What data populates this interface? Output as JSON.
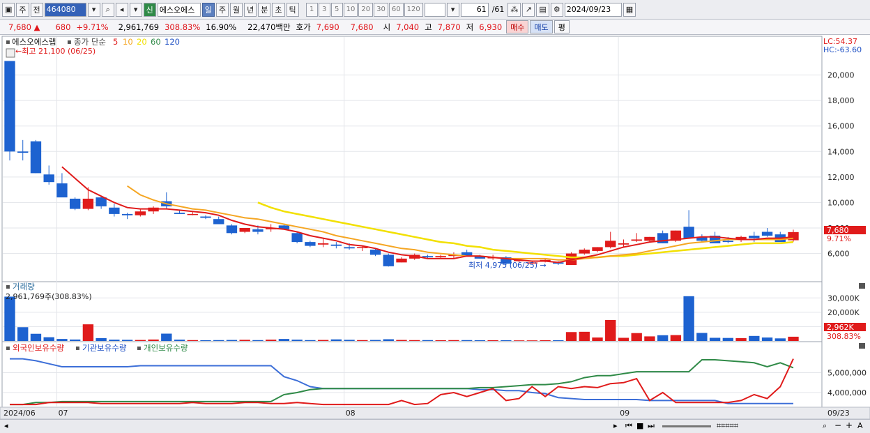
{
  "toolbar": {
    "type_label": "주",
    "market_label": "전",
    "stock_code": "464080",
    "stock_name": "에스오에스",
    "new_badge": "신",
    "periods": [
      "일",
      "주",
      "월",
      "년",
      "분",
      "초",
      "틱"
    ],
    "active_period": "일",
    "numbers": [
      "1",
      "3",
      "5",
      "10",
      "20",
      "30",
      "60",
      "120"
    ],
    "count": "61",
    "count_total": "/61",
    "date": "2024/09/23"
  },
  "quote": {
    "price": "7,680",
    "change_arrow": "▲",
    "change": "680",
    "change_pct": "+9.71%",
    "volume": "2,961,769",
    "volume_pct": "308.83%",
    "turnover": "16.90%",
    "amount": "22,470백만",
    "bid_label": "호가",
    "bid1": "7,690",
    "bid2": "7,680",
    "open_label": "시",
    "open": "7,040",
    "high_label": "고",
    "high": "7,870",
    "low_label": "저",
    "low": "6,930",
    "buy_label": "매수",
    "sell_label": "매도",
    "avg_label": "평"
  },
  "price_panel": {
    "legend_name": "에스오에스랩",
    "legend_ma_label": "종가 단순",
    "ma_periods": [
      "5",
      "10",
      "20",
      "60",
      "120"
    ],
    "ma_colors": [
      "#e01b1b",
      "#f5a623",
      "#f2e000",
      "#2f8a47",
      "#1d4fc4"
    ],
    "high_note": "←최고 21,100 (06/25)",
    "low_note": "최저 4,975 (06/25) →",
    "lc_label": "LC:54.37",
    "hc_label": "HC:-63.60",
    "y_ticks": [
      "20,000",
      "18,000",
      "16,000",
      "14,000",
      "12,000",
      "10,000",
      "8,000",
      "6,000"
    ],
    "last_price_tag": "7,680",
    "last_pct_tag": "9.71%"
  },
  "volume_panel": {
    "title": "거래량",
    "value_note": "2,961,769주(308.83%)",
    "y_ticks": [
      "30,000K",
      "20,000K",
      "10,000K"
    ],
    "last_tag": "2,962K",
    "last_pct_tag": "308.83%"
  },
  "holdings_panel": {
    "legend": [
      "외국인보유수량",
      "기관보유수량",
      "개인보유수량"
    ],
    "legend_colors": [
      "#e01b1b",
      "#1d4fc4",
      "#2f8a47"
    ],
    "y_ticks": [
      "5,000,000",
      "4,000,000"
    ]
  },
  "x_axis": {
    "labels": [
      "2024/06",
      "07",
      "08",
      "09"
    ],
    "end_label": "09/23"
  },
  "chart_data": {
    "type": "candlestick",
    "candles": [
      [
        21100,
        21100,
        13300,
        14000
      ],
      [
        14000,
        14900,
        13300,
        13900
      ],
      [
        14800,
        14900,
        12300,
        12300
      ],
      [
        12200,
        12900,
        11400,
        11600
      ],
      [
        11500,
        12300,
        10500,
        10400
      ],
      [
        10300,
        10400,
        9400,
        9500
      ],
      [
        9500,
        11200,
        9400,
        10300
      ],
      [
        10400,
        10500,
        9500,
        9700
      ],
      [
        9600,
        9900,
        8900,
        9100
      ],
      [
        9100,
        9200,
        8700,
        9000
      ],
      [
        9000,
        9500,
        8900,
        9300
      ],
      [
        9300,
        9700,
        9100,
        9600
      ],
      [
        10100,
        10800,
        9500,
        9700
      ],
      [
        9200,
        9400,
        9100,
        9100
      ],
      [
        9100,
        9300,
        9000,
        9100
      ],
      [
        8900,
        9000,
        8700,
        8800
      ],
      [
        8700,
        8900,
        8400,
        8300
      ],
      [
        8200,
        8300,
        7500,
        7600
      ],
      [
        7700,
        8000,
        7600,
        8000
      ],
      [
        7900,
        8200,
        7500,
        7700
      ],
      [
        7900,
        8300,
        7700,
        8000
      ],
      [
        8200,
        8300,
        7900,
        7900
      ],
      [
        7600,
        7700,
        6800,
        6900
      ],
      [
        6900,
        7000,
        6500,
        6600
      ],
      [
        6700,
        7200,
        6500,
        6800
      ],
      [
        6700,
        6900,
        6400,
        6600
      ],
      [
        6500,
        6800,
        6300,
        6400
      ],
      [
        6500,
        6600,
        6200,
        6500
      ],
      [
        6300,
        6400,
        5800,
        5900
      ],
      [
        5900,
        6000,
        4975,
        5000
      ],
      [
        5300,
        5700,
        5300,
        5600
      ],
      [
        5600,
        6000,
        5500,
        5900
      ],
      [
        5800,
        5900,
        5600,
        5700
      ],
      [
        5700,
        5900,
        5600,
        5800
      ],
      [
        5800,
        6100,
        5600,
        5900
      ],
      [
        6100,
        6300,
        5800,
        5800
      ],
      [
        5800,
        5900,
        5600,
        5600
      ],
      [
        5700,
        5900,
        5500,
        5700
      ],
      [
        5700,
        5800,
        5100,
        5200
      ],
      [
        5400,
        5600,
        5300,
        5500
      ],
      [
        5300,
        5400,
        5200,
        5300
      ],
      [
        5400,
        5600,
        5300,
        5500
      ],
      [
        5300,
        5400,
        5100,
        5200
      ],
      [
        5100,
        6100,
        5100,
        6000
      ],
      [
        6000,
        6400,
        5900,
        6300
      ],
      [
        6200,
        6500,
        6100,
        6500
      ],
      [
        6500,
        7700,
        6400,
        7000
      ],
      [
        6700,
        7100,
        6500,
        6800
      ],
      [
        7000,
        7600,
        6900,
        7100
      ],
      [
        7000,
        7300,
        6900,
        7300
      ],
      [
        7600,
        7800,
        6800,
        6800
      ],
      [
        7000,
        7800,
        6900,
        7800
      ],
      [
        8100,
        9400,
        7200,
        7200
      ],
      [
        7300,
        7500,
        6900,
        7000
      ],
      [
        7400,
        7700,
        6900,
        6800
      ],
      [
        7000,
        7300,
        6800,
        6900
      ],
      [
        7100,
        7400,
        6900,
        7300
      ],
      [
        7400,
        7700,
        6900,
        7200
      ],
      [
        7700,
        8000,
        7300,
        7400
      ],
      [
        7500,
        7700,
        7000,
        6900
      ],
      [
        7040,
        7870,
        6930,
        7680
      ]
    ],
    "volume_k": [
      30900,
      9600,
      5000,
      2600,
      1400,
      1000,
      11600,
      2000,
      900,
      800,
      700,
      1000,
      5100,
      900,
      600,
      500,
      600,
      700,
      800,
      600,
      900,
      1400,
      900,
      600,
      700,
      1100,
      800,
      600,
      700,
      1200,
      700,
      600,
      600,
      500,
      600,
      600,
      500,
      500,
      500,
      400,
      400,
      500,
      500,
      6200,
      6400,
      2400,
      14600,
      2200,
      5500,
      3200,
      4000,
      4100,
      31200,
      5600,
      2200,
      2100,
      2000,
      3500,
      2400,
      1800,
      2962
    ],
    "ma5": [
      null,
      null,
      null,
      null,
      12800,
      11900,
      11000,
      10500,
      10000,
      9600,
      9500,
      9500,
      9500,
      9400,
      9300,
      9200,
      9000,
      8600,
      8300,
      8100,
      8000,
      7900,
      7700,
      7400,
      7200,
      7000,
      6700,
      6600,
      6400,
      6100,
      5900,
      5800,
      5600,
      5600,
      5600,
      5800,
      5800,
      5700,
      5600,
      5500,
      5400,
      5400,
      5300,
      5500,
      5700,
      5900,
      6200,
      6500,
      6700,
      6900,
      7000,
      7100,
      7200,
      7300,
      7300,
      7200,
      7100,
      7100,
      7200,
      7200,
      7300
    ],
    "ma10": [
      null,
      null,
      null,
      null,
      null,
      null,
      null,
      null,
      null,
      11300,
      10600,
      10200,
      9900,
      9700,
      9500,
      9400,
      9200,
      9000,
      8800,
      8700,
      8500,
      8300,
      8100,
      7900,
      7700,
      7400,
      7200,
      7000,
      6800,
      6600,
      6400,
      6300,
      6100,
      6000,
      5900,
      5800,
      5800,
      5700,
      5600,
      5600,
      5600,
      5600,
      5500,
      5500,
      5600,
      5700,
      5800,
      5900,
      6000,
      6200,
      6400,
      6600,
      6800,
      6900,
      7000,
      7100,
      7100,
      7100,
      7100,
      7100,
      7200
    ],
    "ma20": [
      null,
      null,
      null,
      null,
      null,
      null,
      null,
      null,
      null,
      null,
      null,
      null,
      null,
      null,
      null,
      null,
      null,
      null,
      null,
      10000,
      9600,
      9300,
      9100,
      8900,
      8700,
      8500,
      8300,
      8100,
      7900,
      7700,
      7500,
      7300,
      7100,
      6900,
      6800,
      6600,
      6500,
      6300,
      6200,
      6100,
      6000,
      5900,
      5800,
      5700,
      5700,
      5700,
      5800,
      5800,
      5900,
      6000,
      6100,
      6200,
      6300,
      6400,
      6500,
      6600,
      6700,
      6800,
      6800,
      6800,
      6900
    ],
    "foreign": [
      3.4,
      3.4,
      3.4,
      3.5,
      3.5,
      3.5,
      3.5,
      3.45,
      3.45,
      3.45,
      3.45,
      3.45,
      3.45,
      3.45,
      3.5,
      3.45,
      3.45,
      3.45,
      3.5,
      3.5,
      3.45,
      3.45,
      3.5,
      3.45,
      3.4,
      3.4,
      3.4,
      3.4,
      3.4,
      3.4,
      3.6,
      3.4,
      3.45,
      3.9,
      4.0,
      3.8,
      4.0,
      4.2,
      3.6,
      3.7,
      4.3,
      3.8,
      4.3,
      4.2,
      4.3,
      4.25,
      4.45,
      4.5,
      4.7,
      3.6,
      4.0,
      3.5,
      3.5,
      3.5,
      3.5,
      3.5,
      3.6,
      3.9,
      3.7,
      4.3,
      5.7
    ],
    "institution": [
      5.7,
      5.7,
      5.6,
      5.45,
      5.3,
      5.3,
      5.3,
      5.3,
      5.3,
      5.3,
      5.35,
      5.35,
      5.35,
      5.35,
      5.35,
      5.35,
      5.35,
      5.35,
      5.35,
      5.35,
      5.35,
      4.8,
      4.6,
      4.3,
      4.2,
      4.2,
      4.2,
      4.2,
      4.2,
      4.2,
      4.2,
      4.2,
      4.2,
      4.2,
      4.2,
      4.2,
      4.15,
      4.15,
      4.1,
      4.1,
      4.0,
      3.95,
      3.75,
      3.7,
      3.65,
      3.65,
      3.65,
      3.65,
      3.65,
      3.6,
      3.6,
      3.6,
      3.6,
      3.6,
      3.6,
      3.45,
      3.45,
      3.45,
      3.45,
      3.45,
      3.45
    ],
    "individual": [
      3.4,
      3.4,
      3.5,
      3.5,
      3.55,
      3.55,
      3.55,
      3.55,
      3.55,
      3.55,
      3.55,
      3.55,
      3.55,
      3.55,
      3.55,
      3.55,
      3.55,
      3.55,
      3.55,
      3.55,
      3.55,
      3.9,
      4.0,
      4.15,
      4.2,
      4.2,
      4.2,
      4.2,
      4.2,
      4.2,
      4.2,
      4.2,
      4.2,
      4.2,
      4.2,
      4.2,
      4.25,
      4.25,
      4.3,
      4.35,
      4.4,
      4.4,
      4.45,
      4.55,
      4.75,
      4.85,
      4.85,
      4.95,
      5.05,
      5.05,
      5.05,
      5.05,
      5.05,
      5.65,
      5.65,
      5.6,
      5.55,
      5.5,
      5.3,
      5.5,
      5.25
    ],
    "holdings_unit": "millions of shares",
    "ylim_price": [
      4500,
      22000
    ],
    "ylim_volume_k": [
      0,
      35000
    ],
    "ylim_holdings_m": [
      3.3,
      6.0
    ]
  }
}
